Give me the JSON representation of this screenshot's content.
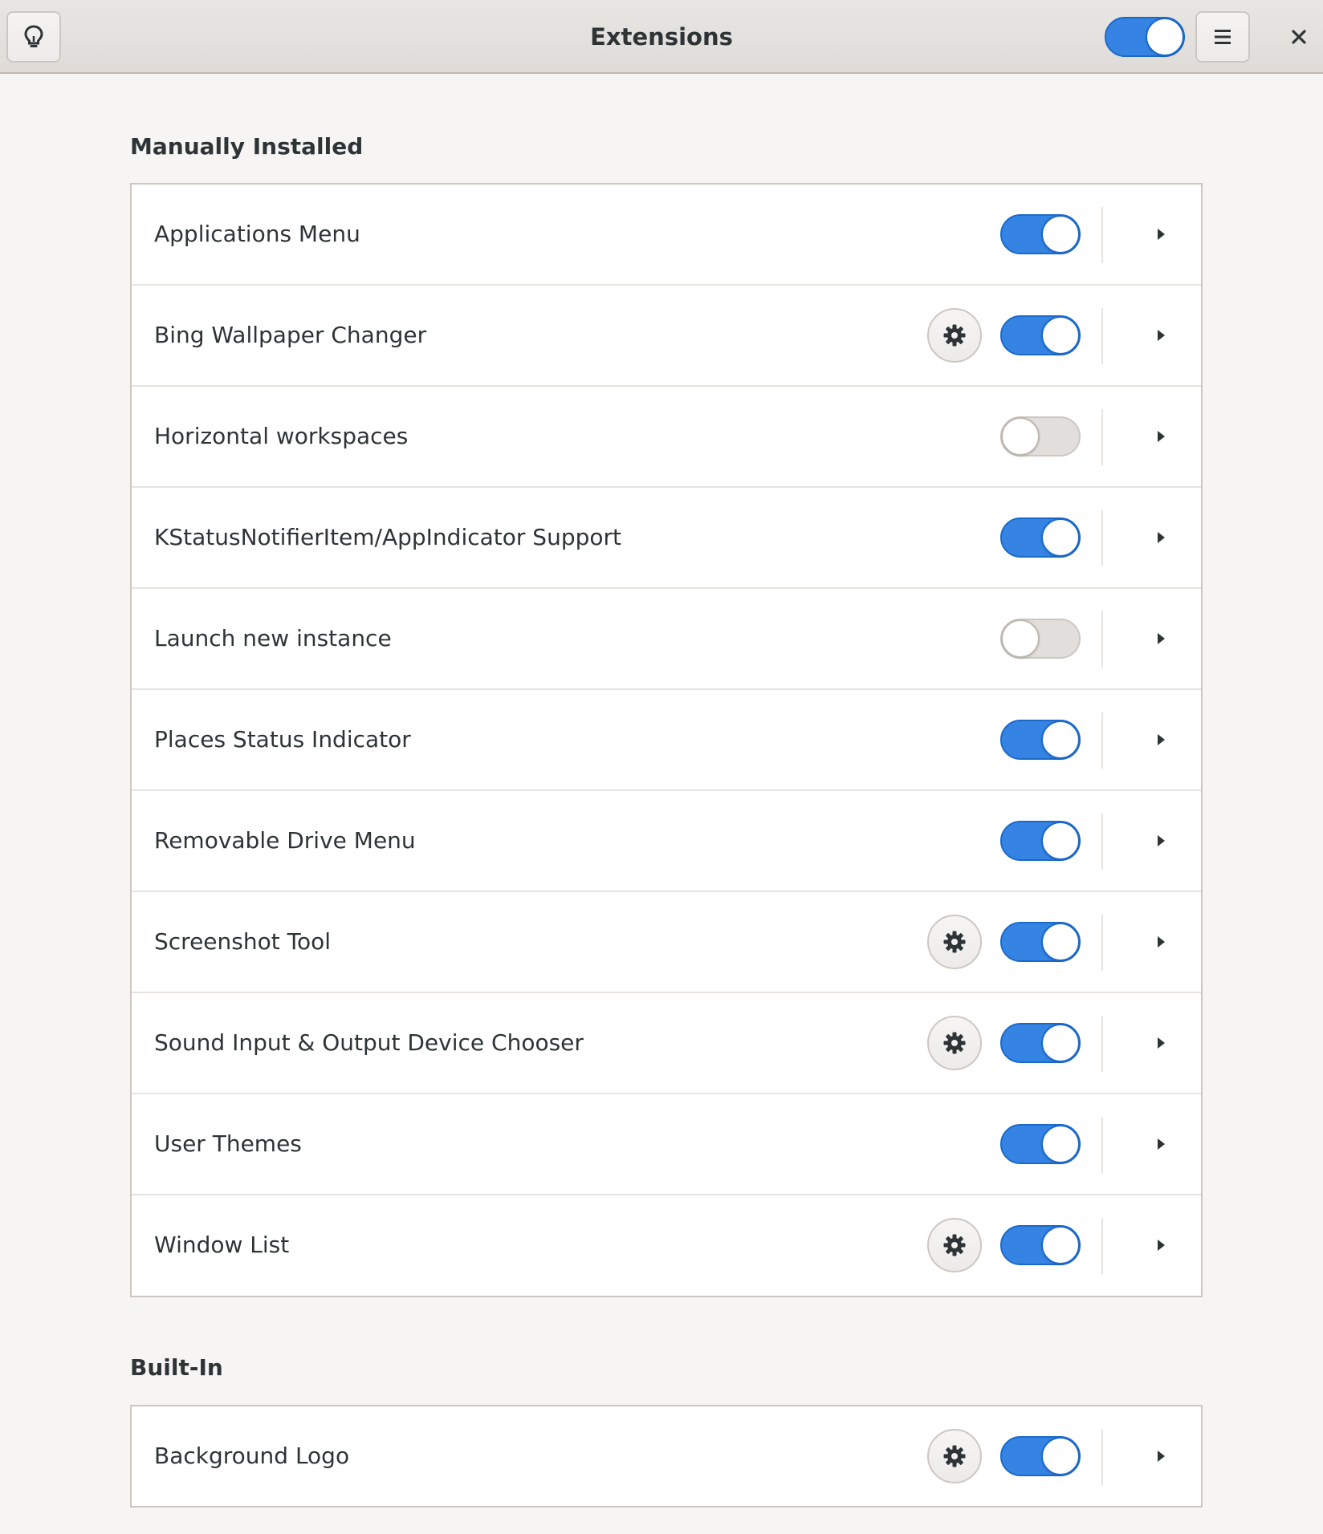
{
  "window": {
    "title": "Extensions",
    "global_switch_on": true
  },
  "icons": {
    "tips": "lightbulb-icon",
    "menu": "hamburger-menu-icon",
    "close": "close-icon",
    "settings": "gear-icon",
    "expand": "triangle-right-icon"
  },
  "colors": {
    "accent": "#3584e4",
    "switch_off": "#e1dedb",
    "background": "#f6f5f4",
    "text": "#2e3436"
  },
  "sections": [
    {
      "title": "Manually Installed",
      "items": [
        {
          "name": "Applications Menu",
          "enabled": true,
          "has_settings": false
        },
        {
          "name": "Bing Wallpaper Changer",
          "enabled": true,
          "has_settings": true
        },
        {
          "name": "Horizontal workspaces",
          "enabled": false,
          "has_settings": false
        },
        {
          "name": "KStatusNotifierItem/AppIndicator Support",
          "enabled": true,
          "has_settings": false
        },
        {
          "name": "Launch new instance",
          "enabled": false,
          "has_settings": false
        },
        {
          "name": "Places Status Indicator",
          "enabled": true,
          "has_settings": false
        },
        {
          "name": "Removable Drive Menu",
          "enabled": true,
          "has_settings": false
        },
        {
          "name": "Screenshot Tool",
          "enabled": true,
          "has_settings": true
        },
        {
          "name": "Sound Input & Output Device Chooser",
          "enabled": true,
          "has_settings": true
        },
        {
          "name": "User Themes",
          "enabled": true,
          "has_settings": false
        },
        {
          "name": "Window List",
          "enabled": true,
          "has_settings": true
        }
      ]
    },
    {
      "title": "Built-In",
      "items": [
        {
          "name": "Background Logo",
          "enabled": true,
          "has_settings": true
        }
      ]
    }
  ]
}
